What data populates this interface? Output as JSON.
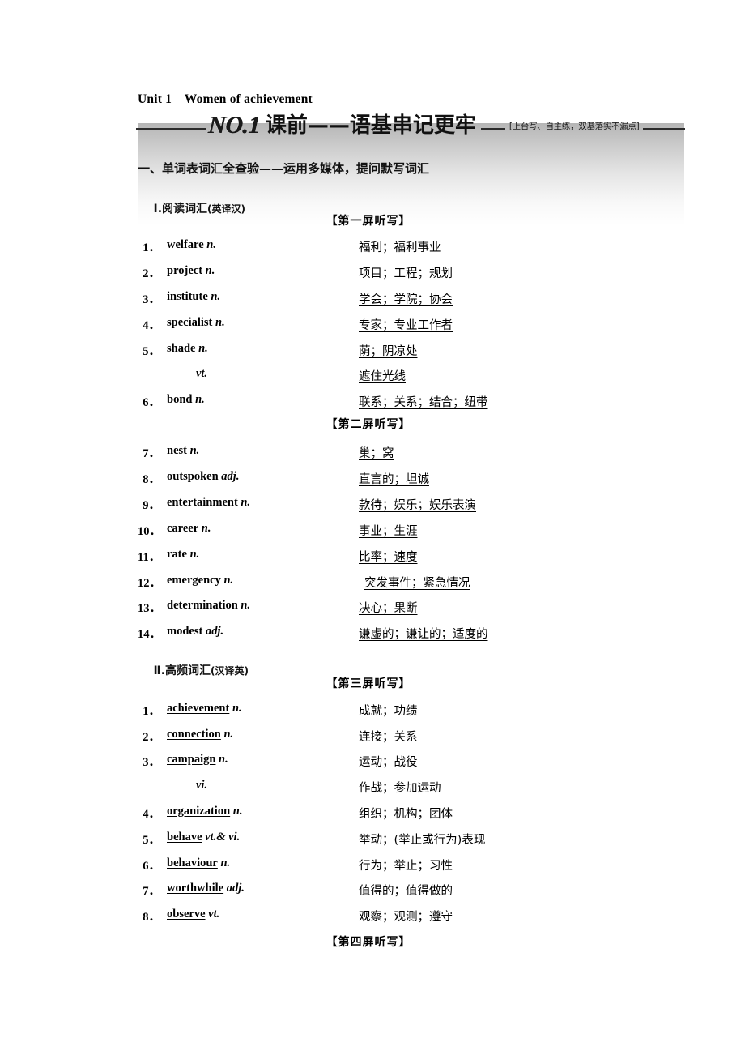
{
  "page": {
    "unit_heading": "Unit 1　Women of achievement"
  },
  "banner": {
    "no_label": "NO.1",
    "title": "课前——语基串记更牢",
    "note": "[上台写、自主练，双基落实不漏点]"
  },
  "sections": {
    "part_one_heading": "一、单词表词汇全查验——运用多媒体，提问默写词汇",
    "sub_one_heading": "Ⅰ.阅读词汇",
    "sub_one_paren": "(英译汉)",
    "sub_two_heading": "Ⅱ.高频词汇",
    "sub_two_paren": "(汉译英)"
  },
  "screen_labels": {
    "one": "【第一屏听写】",
    "two": "【第二屏听写】",
    "three": "【第三屏听写】",
    "four": "【第四屏听写】"
  },
  "reading_vocab": [
    {
      "num": "1．",
      "word": "welfare",
      "pos": "n.",
      "answer": "福利；福利事业"
    },
    {
      "num": "2．",
      "word": "project",
      "pos": "n.",
      "answer": "项目；工程；规划"
    },
    {
      "num": "3．",
      "word": "institute",
      "pos": "n.",
      "answer": "学会；学院；协会"
    },
    {
      "num": "4．",
      "word": "specialist",
      "pos": "n.",
      "answer": "专家；专业工作者"
    },
    {
      "num": "5．",
      "word": "shade",
      "pos": "n.",
      "answer": "荫；阴凉处"
    },
    {
      "num": "",
      "word": "",
      "pos": "vt.",
      "answer": "遮住光线",
      "sub": true
    },
    {
      "num": "6．",
      "word": "bond",
      "pos": "n.",
      "answer": "联系；关系；结合；纽带"
    },
    {
      "num": "7．",
      "word": "nest",
      "pos": "n.",
      "answer": "巢；窝"
    },
    {
      "num": "8．",
      "word": "outspoken",
      "pos": "adj.",
      "answer": "直言的；坦诚"
    },
    {
      "num": "9．",
      "word": "entertainment",
      "pos": "n.",
      "answer": "款待；娱乐；娱乐表演"
    },
    {
      "num": "10．",
      "word": "career",
      "pos": "n.",
      "answer": "事业；生涯"
    },
    {
      "num": "11．",
      "word": "rate",
      "pos": "n.",
      "answer": "比率；速度"
    },
    {
      "num": "12．",
      "word": "emergency",
      "pos": "n.",
      "answer": "突发事件；紧急情况",
      "indent": true
    },
    {
      "num": "13．",
      "word": "determination",
      "pos": "n.",
      "answer": "决心；果断"
    },
    {
      "num": "14．",
      "word": "modest",
      "pos": "adj.",
      "answer": "谦虚的；谦让的；适度的"
    }
  ],
  "frequent_vocab": [
    {
      "num": "1．",
      "word": "achievement",
      "pos": "n.",
      "answer": "成就；功绩"
    },
    {
      "num": "2．",
      "word": "connection",
      "pos": "n.",
      "answer": "连接；关系"
    },
    {
      "num": "3．",
      "word": "campaign",
      "pos": "n.",
      "answer": "运动；战役"
    },
    {
      "num": "",
      "word": "",
      "pos": "vi.",
      "answer": "作战；参加运动",
      "sub": true
    },
    {
      "num": "4．",
      "word": "organization",
      "pos": "n.",
      "answer": "组织；机构；团体"
    },
    {
      "num": "5．",
      "word": "behave",
      "pos": "vt.& vi.",
      "answer": "举动；(举止或行为)表现"
    },
    {
      "num": "6．",
      "word": "behaviour",
      "pos": "n.",
      "answer": "行为；举止；习性"
    },
    {
      "num": "7．",
      "word": "worthwhile",
      "pos": "adj.",
      "answer": "值得的；值得做的"
    },
    {
      "num": "8．",
      "word": "observe",
      "pos": "vt.",
      "answer": "观察；观测；遵守"
    }
  ],
  "colors": {
    "text": "#000000",
    "band": "#b2b2b2",
    "rule": "#2b2b2b"
  }
}
